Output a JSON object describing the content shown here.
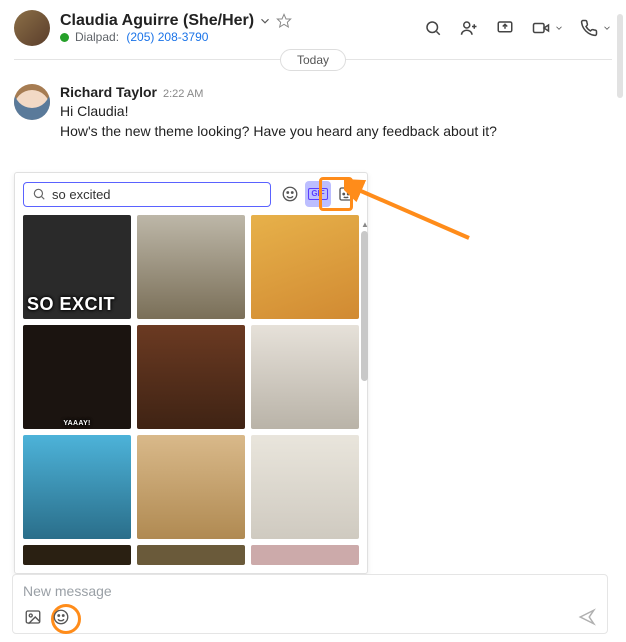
{
  "header": {
    "contact_name": "Claudia Aguirre (She/Her)",
    "service_label": "Dialpad:",
    "phone_number": "(205) 208-3790"
  },
  "date_badge": "Today",
  "message": {
    "sender": "Richard Taylor",
    "time": "2:22 AM",
    "line1": "Hi Claudia!",
    "line2": "How's the new theme looking? Have you heard any feedback about it?"
  },
  "picker": {
    "search_value": "so excited",
    "search_placeholder": "Search",
    "tiles": [
      {
        "caption": "SO EXCIT",
        "bg": "#2a2a2a"
      },
      {
        "caption": "",
        "bg": "linear-gradient(180deg,#bdb7a8,#7a6f58)"
      },
      {
        "caption": "",
        "bg": "linear-gradient(160deg,#e7b14a,#d18a32)"
      },
      {
        "caption": "YAAAY!",
        "bg": "#1b1410",
        "small": true
      },
      {
        "caption": "",
        "bg": "linear-gradient(180deg,#6b3a22,#3f2314)"
      },
      {
        "caption": "",
        "bg": "linear-gradient(180deg,#e6e1d9,#b9b3a8)"
      },
      {
        "caption": "",
        "bg": "linear-gradient(180deg,#4db3d9,#2a6e8a)"
      },
      {
        "caption": "",
        "bg": "linear-gradient(180deg,#d9b98a,#b08a52)"
      },
      {
        "caption": "",
        "bg": "linear-gradient(180deg,#e9e5dc,#cfcac0)"
      },
      {
        "caption": "",
        "bg": "#2a2012"
      },
      {
        "caption": "",
        "bg": "#6a5a3a"
      },
      {
        "caption": "",
        "bg": "#caa"
      }
    ]
  },
  "composer": {
    "placeholder": "New message"
  }
}
